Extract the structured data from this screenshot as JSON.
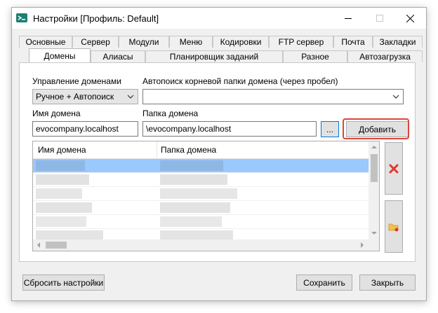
{
  "window": {
    "title": "Настройки [Профиль: Default]"
  },
  "tabs_row1": [
    "Основные",
    "Сервер",
    "Модули",
    "Меню",
    "Кодировки",
    "FTP сервер",
    "Почта",
    "Закладки"
  ],
  "tabs_row2": [
    "Домены",
    "Алиасы",
    "Планировщик заданий",
    "Разное",
    "Автозагрузка"
  ],
  "active_tab": "Домены",
  "domains": {
    "management_label": "Управление доменами",
    "management_value": "Ручное + Автопоиск",
    "autosearch_label": "Автопоиск корневой папки домена (через пробел)",
    "autosearch_value": "",
    "domain_name_label": "Имя домена",
    "domain_name_value": "evocompany.localhost",
    "domain_folder_label": "Папка домена",
    "domain_folder_value": "\\evocompany.localhost",
    "browse_label": "...",
    "add_label": "Добавить"
  },
  "table": {
    "columns": [
      "Имя домена",
      "Папка домена"
    ],
    "selected_row": 0
  },
  "footer": {
    "reset_label": "Сбросить настройки",
    "save_label": "Сохранить",
    "close_label": "Закрыть"
  },
  "colors": {
    "highlight": "#d9463b",
    "selection": "#99c9ff",
    "delete_icon": "#e0382e",
    "folder_icon": "#f2c14e"
  }
}
